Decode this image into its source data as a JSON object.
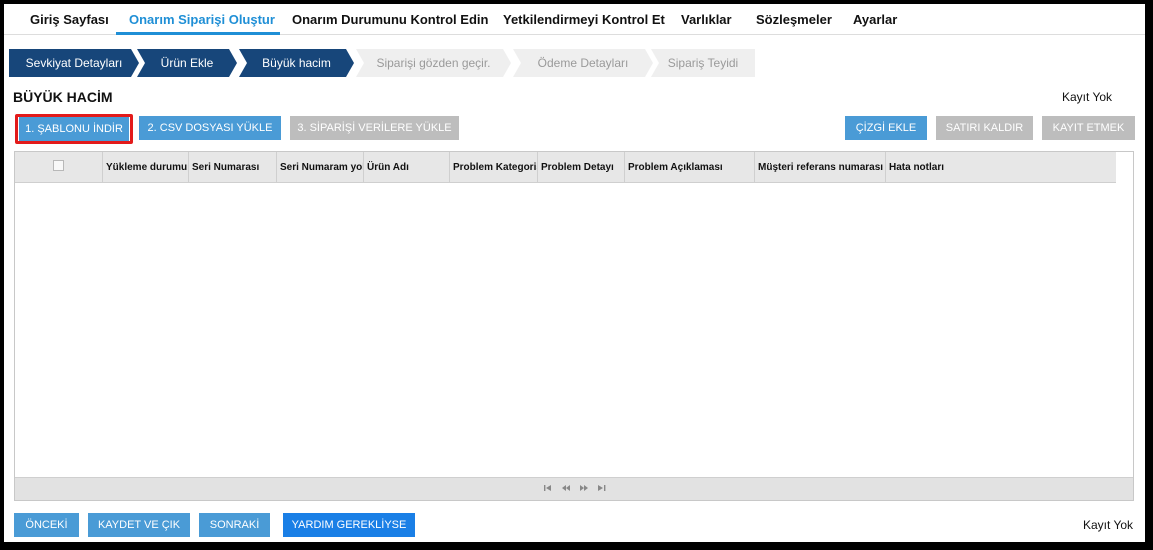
{
  "nav": {
    "items": [
      "Giriş Sayfası",
      "Onarım Siparişi Oluştur",
      "Onarım Durumunu Kontrol Edin",
      "Yetkilendirmeyi Kontrol Et",
      "Varlıklar",
      "Sözleşmeler",
      "Ayarlar"
    ],
    "active_index": 1
  },
  "steps": [
    {
      "label": "Sevkiyat Detayları",
      "state": "done"
    },
    {
      "label": "Ürün Ekle",
      "state": "done"
    },
    {
      "label": "Büyük hacim",
      "state": "done"
    },
    {
      "label": "Siparişi gözden geçir.",
      "state": "todo"
    },
    {
      "label": "Ödeme Detayları",
      "state": "todo"
    },
    {
      "label": "Sipariş Teyidi",
      "state": "todo"
    }
  ],
  "section_title": "BÜYÜK HACİM",
  "no_record_top": "Kayıt Yok",
  "no_record_bottom": "Kayıt Yok",
  "actions": {
    "download_template": "1. ŞABLONU İNDİR",
    "upload_csv": "2. CSV DOSYASI YÜKLE",
    "upload_order": "3. SİPARİŞİ VERİLERE YÜKLE",
    "add_line": "ÇİZGİ EKLE",
    "remove_row": "SATIRI KALDIR",
    "save_record": "KAYIT ETMEK"
  },
  "table": {
    "columns": [
      "Yükleme durumu b",
      "Seri Numarası",
      "Seri Numaram yok",
      "Ürün Adı",
      "Problem Kategoris",
      "Problem Detayı",
      "Problem Açıklaması",
      "Müşteri referans numarası",
      "Hata notları"
    ]
  },
  "pager_icons": [
    "first-page-icon",
    "prev-page-icon",
    "next-page-icon",
    "last-page-icon"
  ],
  "footer": {
    "prev": "ÖNCEKİ",
    "save_exit": "KAYDET VE ÇIK",
    "next": "SONRAKİ",
    "help": "YARDIM GEREKLİYSE"
  },
  "colors": {
    "accent": "#1f8fd6",
    "step_done": "#17467a",
    "step_todo": "#efefef",
    "button_blue": "#4a9bd6",
    "button_gray": "#bdbdbd",
    "button_help": "#1a7fe6",
    "highlight": "#e31b1b"
  }
}
